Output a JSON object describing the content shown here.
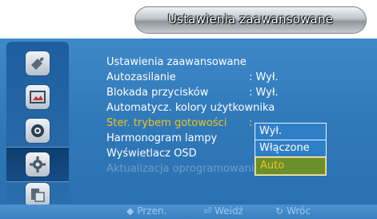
{
  "osd": {
    "title": "Ustawienia zaawansowane",
    "sidebar": {
      "icons": [
        "satellite-icon",
        "picture-icon",
        "sound-icon",
        "setup-icon",
        "multi-window-icon"
      ],
      "active_index": 3
    },
    "menu": {
      "items": [
        {
          "label": "Ustawienia zaawansowane",
          "value": ""
        },
        {
          "label": "Autozasilanie",
          "value": ": Wył."
        },
        {
          "label": "Blokada przycisków",
          "value": ": Wył."
        },
        {
          "label": "Automatycz. kolory użytkownika",
          "value": ""
        },
        {
          "label": "Ster. trybem gotowości",
          "value": ":",
          "state": "highlight"
        },
        {
          "label": "Harmonogram lampy",
          "value": ""
        },
        {
          "label": "Wyświetlacz OSD",
          "value": ""
        },
        {
          "label": "Aktualizacja oprogramowania",
          "value": "",
          "state": "disabled"
        }
      ]
    },
    "dropdown": {
      "options": [
        "Wył.",
        "Włączone",
        "Auto"
      ],
      "selected": "Auto"
    },
    "footer": {
      "move": "Przen.",
      "enter": "Weidź",
      "back": "Wróc"
    }
  }
}
